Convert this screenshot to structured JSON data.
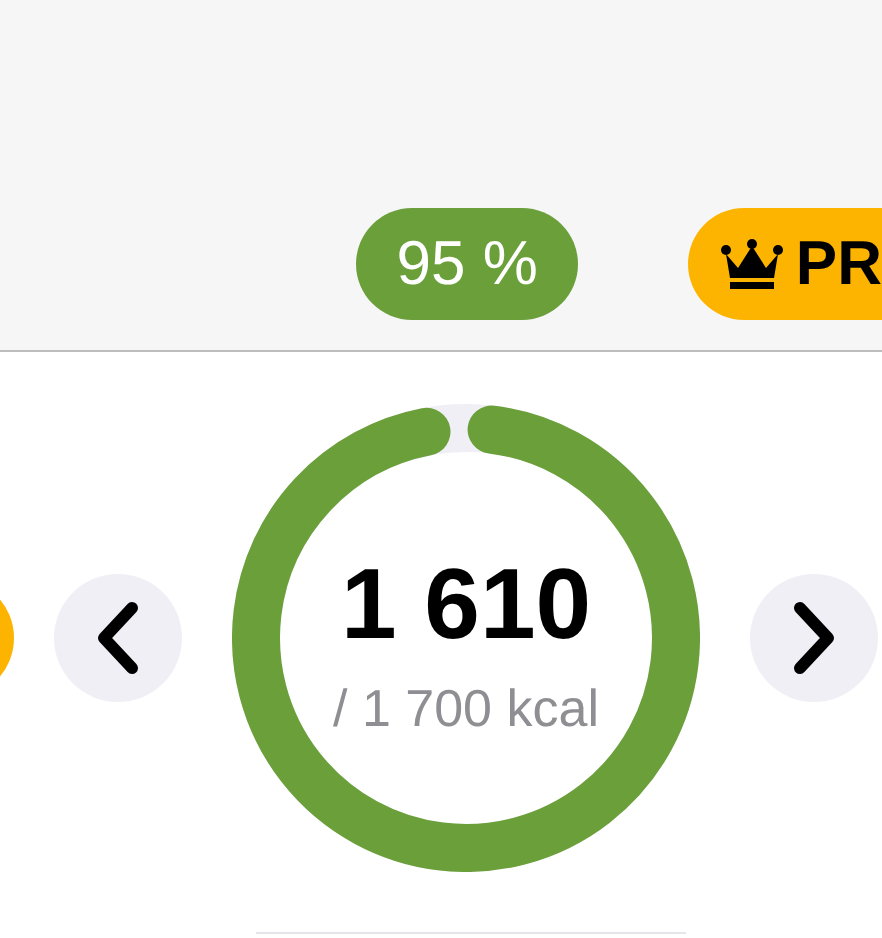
{
  "header": {
    "progress_badge": "95 %",
    "pro_badge": "PR"
  },
  "calories": {
    "eaten": "1 610",
    "goal": "/ 1 700 kcal"
  }
}
